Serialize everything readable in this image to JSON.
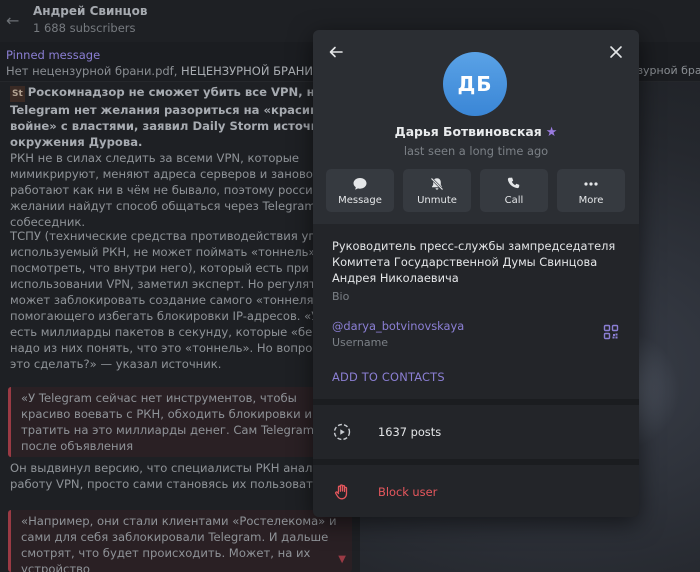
{
  "channel": {
    "title": "Андрей Свинцов",
    "subscribers": "1 688 subscribers"
  },
  "pinned": {
    "label": "Pinned message",
    "text_start": "Нет нецензурной брани.pdf, ",
    "text_bold": "НЕЦЕНЗУРНОЙ БРАНИ – НЕ",
    "text_right": "нзурной бран"
  },
  "messages": {
    "tag": "St",
    "lead": "Роскомнадзор не сможет убить все VPN, но и у Telegram нет желания разориться на «красивой войне» с властями, заявил Daily Storm источник из окружения Дурова.",
    "p1": "РКН не в силах следить за всеми VPN, которые мимикрируют, меняют адреса серверов и заново работают как ни в чём не бывало, поэтому россияне при желании найдут способ общаться через Telegram, уверен собеседник.",
    "p2": "ТСПУ (технические средства противодействия угрозам), используемый РКН, не может поймать «тоннель» (и посмотреть, что внутри него), который есть при использовании VPN, заметил эксперт. Но регулятор может заблокировать создание самого «тоннеля», помогающего избегать блокировки IP-адресов. «У ТСПУ есть миллиарды пакетов в секунду, которые «бегают» и надо из них понять, что это «тоннель». Но вопрос, как это сделать?» — указал источник.",
    "quote1": "«У Telegram сейчас нет инструментов, чтобы красиво воевать с РКН, обходить блокировки и не тратить на это миллиарды денег. Сам Telegram после объявления",
    "p3": "Он выдвинул версию, что специалисты РКН анализируют работу VPN, просто сами становясь их пользователями.",
    "quote2": "«Например, они стали клиентами «Ростелекома» и сами для себя заблокировали Telegram. И дальше смотрят, что будет происходить. Может, на их устройство"
  },
  "profile": {
    "initials": "ДБ",
    "name": "Дарья Ботвиновская",
    "last_seen": "last seen a long time ago",
    "actions": [
      {
        "label": "Message",
        "icon": "message-icon"
      },
      {
        "label": "Unmute",
        "icon": "bell-muted-icon"
      },
      {
        "label": "Call",
        "icon": "phone-icon"
      },
      {
        "label": "More",
        "icon": "more-dots-icon"
      }
    ],
    "bio": "Руководитель пресс-службы зампредседателя Комитета Государственной Думы Свинцова Андрея Николаевича",
    "bio_label": "Bio",
    "username": "@darya_botvinovskaya",
    "username_label": "Username",
    "add_contacts": "ADD TO CONTACTS",
    "posts": "1637 posts",
    "block": "Block user"
  },
  "colors": {
    "accent": "#8b7fd4",
    "avatar": "#4a94e0",
    "danger": "#e6575d",
    "quote_border": "#9a3a44"
  }
}
